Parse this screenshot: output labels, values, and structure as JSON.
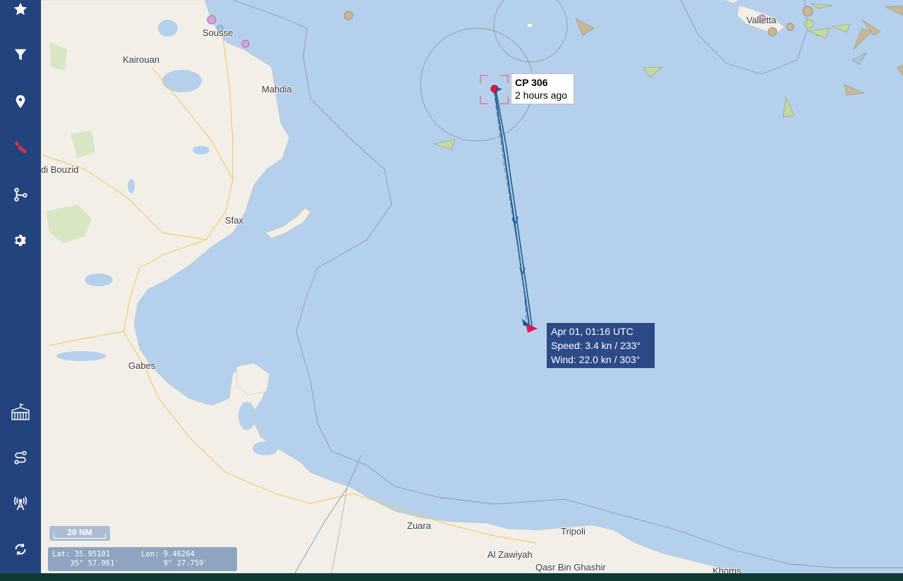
{
  "sidebar": {
    "top_items": [
      {
        "name": "favorites-icon",
        "color": "#ffffff"
      },
      {
        "name": "filter-icon",
        "color": "#ffffff"
      },
      {
        "name": "location-pin-icon",
        "color": "#ffffff"
      },
      {
        "name": "satellite-icon",
        "color": "#e0303a"
      },
      {
        "name": "route-icon",
        "color": "#ffffff"
      },
      {
        "name": "gear-icon",
        "color": "#ffffff"
      }
    ],
    "bottom_items": [
      {
        "name": "port-icon"
      },
      {
        "name": "track-route-icon"
      },
      {
        "name": "antenna-icon"
      },
      {
        "name": "refresh-icon"
      }
    ]
  },
  "map": {
    "places": {
      "sousse": "Sousse",
      "kairouan": "Kairouan",
      "mahdia": "Mahdia",
      "sidi_bouzid": "di Bouzid",
      "sfax": "Sfax",
      "gabes": "Gabes",
      "zuara": "Zuara",
      "tripoli": "Tripoli",
      "al_zawiyah": "Al Zawiyah",
      "qasr_bin_ghashir": "Qasr Bin Ghashir",
      "khoms": "Khoms",
      "valletta": "Valletta"
    },
    "vessel": {
      "name": "CP 306",
      "last_seen": "2 hours ago"
    },
    "tooltip": {
      "time": "Apr 01, 01:16 UTC",
      "speed": "Speed: 3.4 kn / 233°",
      "wind": "Wind: 22.0 kn / 303°"
    },
    "scale": "20 NM",
    "coordinates": {
      "lat_label": "Lat: 35.95101",
      "lat_dms": "    35° 57.061′",
      "lon_label": "Lon: 9.46264",
      "lon_dms": "     9° 27.759′"
    }
  },
  "colors": {
    "sidebar": "#23437f",
    "sea": "#b5d0ec",
    "land": "#f2efe9",
    "track": "#1d5a8f",
    "endpoint": "#e8144c"
  }
}
